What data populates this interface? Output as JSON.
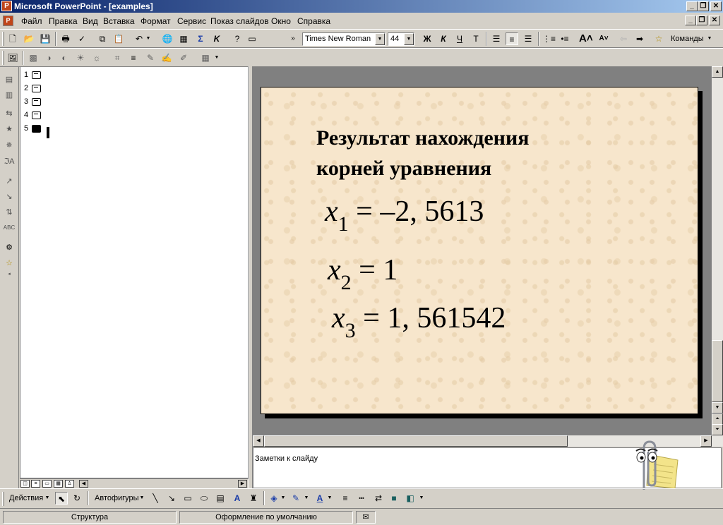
{
  "window": {
    "title": "Microsoft PowerPoint - [examples]",
    "app_icon": "P",
    "controls": {
      "minimize": "_",
      "restore": "❐",
      "close": "✕"
    }
  },
  "menu": {
    "items": [
      "Файл",
      "Правка",
      "Вид",
      "Вставка",
      "Формат",
      "Сервис",
      "Показ слайдов",
      "Окно",
      "Справка"
    ]
  },
  "formatting": {
    "font_name": "Times New Roman",
    "font_size": "44",
    "bold_label": "Ж",
    "italic_label": "К",
    "underline_label": "Ч",
    "shadow_label": "Т",
    "commands_label": "Команды"
  },
  "outline": {
    "slides": [
      {
        "num": "1"
      },
      {
        "num": "2"
      },
      {
        "num": "3"
      },
      {
        "num": "4"
      },
      {
        "num": "5"
      }
    ]
  },
  "slide": {
    "title_line1": "Результат нахождения",
    "title_line2": "корней уравнения",
    "equations": [
      {
        "var": "x",
        "sub": "1",
        "rhs": "= –2, 5613"
      },
      {
        "var": "x",
        "sub": "2",
        "rhs": "= 1"
      },
      {
        "var": "x",
        "sub": "3",
        "rhs": "= 1, 561542"
      }
    ],
    "background_color": "#f7e6cc"
  },
  "notes": {
    "placeholder": "Заметки к слайду"
  },
  "drawing_toolbar": {
    "actions_label": "Действия",
    "autoshapes_label": "Автофигуры"
  },
  "status": {
    "view_name": "Структура",
    "design_name": "Оформление по умолчанию"
  }
}
